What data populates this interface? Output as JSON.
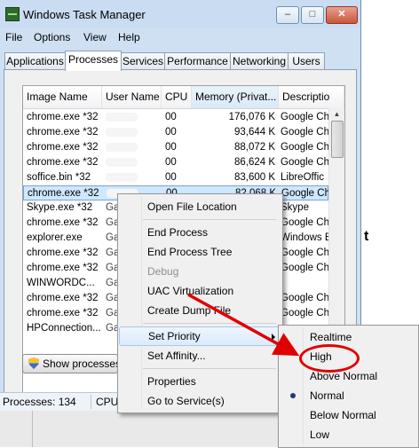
{
  "window": {
    "title": "Windows Task Manager",
    "caption_buttons": {
      "minimize": "–",
      "maximize": "□",
      "close": "✕"
    }
  },
  "menu": [
    "File",
    "Options",
    "View",
    "Help"
  ],
  "tabs": [
    "Applications",
    "Processes",
    "Services",
    "Performance",
    "Networking",
    "Users"
  ],
  "active_tab": "Processes",
  "table": {
    "columns": [
      "Image Name",
      "User Name",
      "CPU",
      "Memory (Privat...",
      "Descriptio"
    ],
    "rows": [
      {
        "name": "chrome.exe *32",
        "user": "",
        "cpu": "00",
        "mem": "176,076 K",
        "desc": "Google Ch"
      },
      {
        "name": "chrome.exe *32",
        "user": "",
        "cpu": "00",
        "mem": "93,644 K",
        "desc": "Google Ch"
      },
      {
        "name": "chrome.exe *32",
        "user": "",
        "cpu": "00",
        "mem": "88,072 K",
        "desc": "Google Ch"
      },
      {
        "name": "chrome.exe *32",
        "user": "",
        "cpu": "00",
        "mem": "86,624 K",
        "desc": "Google Ch"
      },
      {
        "name": "soffice.bin *32",
        "user": "",
        "cpu": "00",
        "mem": "83,600 K",
        "desc": "LibreOffic"
      },
      {
        "name": "chrome.exe *32",
        "user": "",
        "cpu": "00",
        "mem": "82,068 K",
        "desc": "Google Ch"
      },
      {
        "name": "Skype.exe *32",
        "user": "Ga",
        "cpu": "",
        "mem": "",
        "desc": "Skype"
      },
      {
        "name": "chrome.exe *32",
        "user": "Ga",
        "cpu": "",
        "mem": "",
        "desc": "Google Ch"
      },
      {
        "name": "explorer.exe",
        "user": "Ga",
        "cpu": "",
        "mem": "",
        "desc": "Windows E"
      },
      {
        "name": "chrome.exe *32",
        "user": "Ga",
        "cpu": "",
        "mem": "",
        "desc": "Google Ch"
      },
      {
        "name": "chrome.exe *32",
        "user": "Ga",
        "cpu": "",
        "mem": "",
        "desc": "Google Ch"
      },
      {
        "name": "WINWORDC...",
        "user": "Ga",
        "cpu": "",
        "mem": "",
        "desc": ""
      },
      {
        "name": "chrome.exe *32",
        "user": "Ga",
        "cpu": "",
        "mem": "",
        "desc": "Google Ch"
      },
      {
        "name": "chrome.exe *32",
        "user": "Ga",
        "cpu": "",
        "mem": "",
        "desc": "Google Ch"
      },
      {
        "name": "HPConnection...",
        "user": "Ga",
        "cpu": "",
        "mem": "",
        "desc": ""
      }
    ],
    "selected_row": 5
  },
  "show_processes_button": "Show processes f",
  "status": {
    "processes": "Processes: 134",
    "cpu": "CPU"
  },
  "context_menu": {
    "items": [
      {
        "label": "Open File Location",
        "disabled": false
      },
      {
        "sep": true
      },
      {
        "label": "End Process",
        "disabled": false
      },
      {
        "label": "End Process Tree",
        "disabled": false
      },
      {
        "label": "Debug",
        "disabled": true
      },
      {
        "label": "UAC Virtualization",
        "disabled": false
      },
      {
        "label": "Create Dump File",
        "disabled": false
      },
      {
        "sep": true
      },
      {
        "label": "Set Priority",
        "disabled": false,
        "submenu": true,
        "highlighted": true
      },
      {
        "label": "Set Affinity...",
        "disabled": false
      },
      {
        "sep": true
      },
      {
        "label": "Properties",
        "disabled": false
      },
      {
        "label": "Go to Service(s)",
        "disabled": false
      }
    ]
  },
  "priority_submenu": {
    "items": [
      "Realtime",
      "High",
      "Above Normal",
      "Normal",
      "Below Normal",
      "Low"
    ],
    "checked": "Normal",
    "annotated": "High"
  },
  "background_text": "t",
  "colors": {
    "annotation": "#e00000",
    "selection": "#cde8ff",
    "window_frame": "#cfe0f3"
  }
}
